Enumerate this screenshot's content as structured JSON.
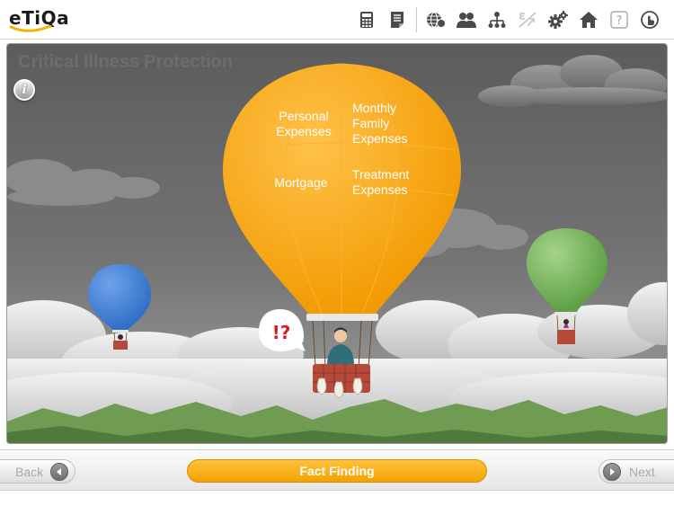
{
  "app": {
    "logo_text": "eTiQa",
    "colors": {
      "brand_accent": "#f2a31b",
      "logo_swoosh": "#f4b400",
      "icon": "#4a4a4a"
    }
  },
  "toolbar": {
    "icons": [
      "calculator-icon",
      "notes-icon",
      "globe-icon",
      "users-icon",
      "org-chart-icon",
      "disabled-tool-icon",
      "settings-icon",
      "home-icon",
      "help-icon",
      "touch-icon"
    ]
  },
  "stage": {
    "title_words": [
      "Critical",
      "Illness",
      "Protection"
    ],
    "info_label": "i",
    "balloon_labels": {
      "personal": "Personal Expenses",
      "monthly": "Monthly Family Expenses",
      "mortgage": "Mortgage",
      "treatment": "Treatment Expenses"
    },
    "speech_bubble": "!?"
  },
  "footer": {
    "back_label": "Back",
    "center_label": "Fact Finding",
    "next_label": "Next"
  }
}
